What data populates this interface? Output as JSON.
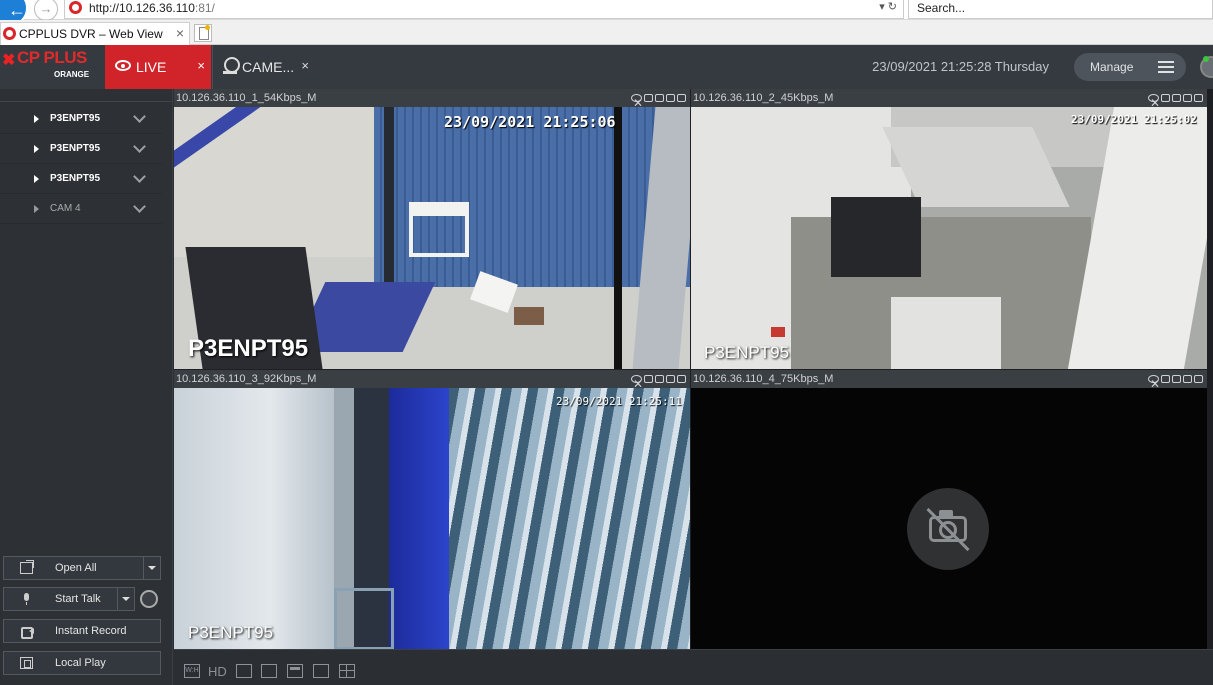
{
  "browser": {
    "url": "http://10.126.36.110",
    "url_port": ":81/",
    "search_placeholder": "Search...",
    "tab_title": "CPPLUS DVR – Web View"
  },
  "app": {
    "logo_text": "CP PLUS",
    "logo_sub": "ORANGE",
    "tabs": [
      {
        "label": "LIVE"
      },
      {
        "label": "CAME..."
      }
    ],
    "datetime": "23/09/2021 21:25:28 Thursday",
    "manage_label": "Manage"
  },
  "sidebar": {
    "devices": [
      {
        "label": "P3ENPT95"
      },
      {
        "label": "P3ENPT95"
      },
      {
        "label": "P3ENPT95"
      },
      {
        "label": "CAM 4"
      }
    ],
    "buttons": {
      "open_all": "Open All",
      "start_talk": "Start Talk",
      "instant_record": "Instant Record",
      "local_play": "Local Play"
    }
  },
  "panes": [
    {
      "title": "10.126.36.110_1_54Kbps_M",
      "osd_time": "23/09/2021  21:25:06",
      "osd_name": "P3ENPT95"
    },
    {
      "title": "10.126.36.110_2_45Kbps_M",
      "osd_time": "23/09/2021  21:25:02",
      "osd_name": "P3ENPT95"
    },
    {
      "title": "10.126.36.110_3_92Kbps_M",
      "osd_time": "23/09/2021  21:25:11",
      "osd_name": "P3ENPT95"
    },
    {
      "title": "10.126.36.110_4_75Kbps_M",
      "osd_time": "",
      "osd_name": ""
    }
  ],
  "toolbar": {
    "wh_label": "W:H",
    "hd_label": "HD"
  },
  "colors": {
    "accent": "#d1232a",
    "active_pane_border": "#52c24a",
    "header_bg": "#343a40"
  }
}
